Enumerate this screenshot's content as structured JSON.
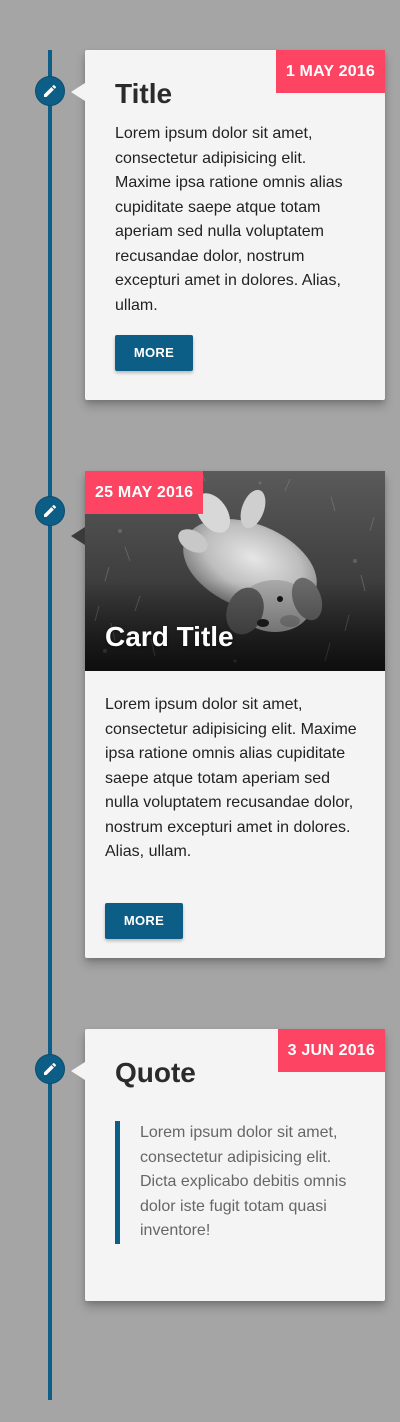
{
  "colors": {
    "background": "#a5a5a5",
    "accent": "#0d5e86",
    "date_badge": "#fd4563",
    "card": "#f4f4f4"
  },
  "timeline": {
    "marker_icon": "pencil-icon",
    "items": [
      {
        "type": "text",
        "date": "1 MAY 2016",
        "title": "Title",
        "text": "Lorem ipsum dolor sit amet, consectetur adipisicing elit. Maxime ipsa ratione omnis alias cupiditate saepe atque totam aperiam sed nulla voluptatem recusandae dolor, nostrum excepturi amet in dolores. Alias, ullam.",
        "button_label": "MORE"
      },
      {
        "type": "image",
        "date": "25 MAY 2016",
        "title": "Card Title",
        "image": "dog-photo",
        "text": "Lorem ipsum dolor sit amet, consectetur adipisicing elit. Maxime ipsa ratione omnis alias cupiditate saepe atque totam aperiam sed nulla voluptatem recusandae dolor, nostrum excepturi amet in dolores. Alias, ullam.",
        "button_label": "MORE"
      },
      {
        "type": "quote",
        "date": "3 JUN 2016",
        "title": "Quote",
        "quote": "Lorem ipsum dolor sit amet, consectetur adipisicing elit. Dicta explicabo debitis omnis dolor iste fugit totam quasi inventore!"
      }
    ]
  }
}
